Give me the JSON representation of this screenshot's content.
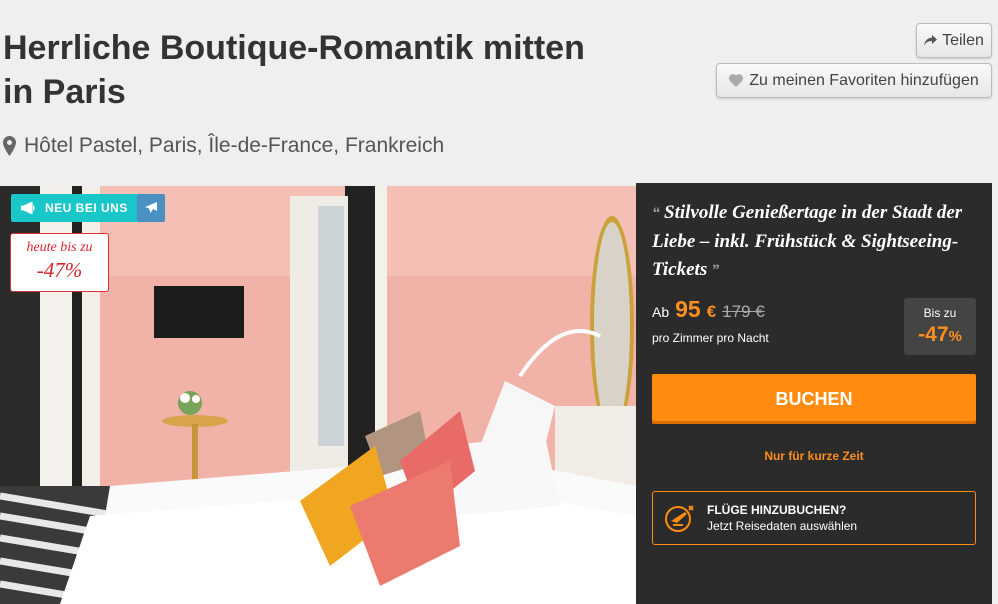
{
  "hotel": {
    "title": "Herrliche Boutique-Romantik mitten in Paris",
    "location": "Hôtel Pastel, Paris, Île-de-France, Frankreich"
  },
  "actions": {
    "share_label": "Teilen",
    "favorite_label": "Zu meinen Favoriten hinzufügen"
  },
  "badges": {
    "new_label": "NEU BEI UNS",
    "discount_line1": "heute bis zu",
    "discount_line2": "-47%"
  },
  "offer": {
    "quote": "Stilvolle Genießertage in der Stadt der Liebe – inkl. Frühstück & Sightseeing-Tickets",
    "price_prefix": "Ab",
    "price": "95",
    "currency": "€",
    "old_price": "179 €",
    "price_unit": "pro Zimmer pro Nacht",
    "upto_label": "Bis zu",
    "upto_value": "-47",
    "upto_percent": "%",
    "book_label": "BUCHEN",
    "limited_label": "Nur für kurze Zeit",
    "flights_title": "FLÜGE HINZUBUCHEN?",
    "flights_subtitle": "Jetzt Reisedaten auswählen"
  },
  "colors": {
    "accent": "#ff8c10",
    "panel": "#2b2b2b",
    "teal": "#19c6c8",
    "discount_red": "#d0262d"
  },
  "icons": [
    "map-pin-icon",
    "share-icon",
    "heart-icon",
    "megaphone-icon",
    "plane-icon",
    "flight-add-icon"
  ]
}
